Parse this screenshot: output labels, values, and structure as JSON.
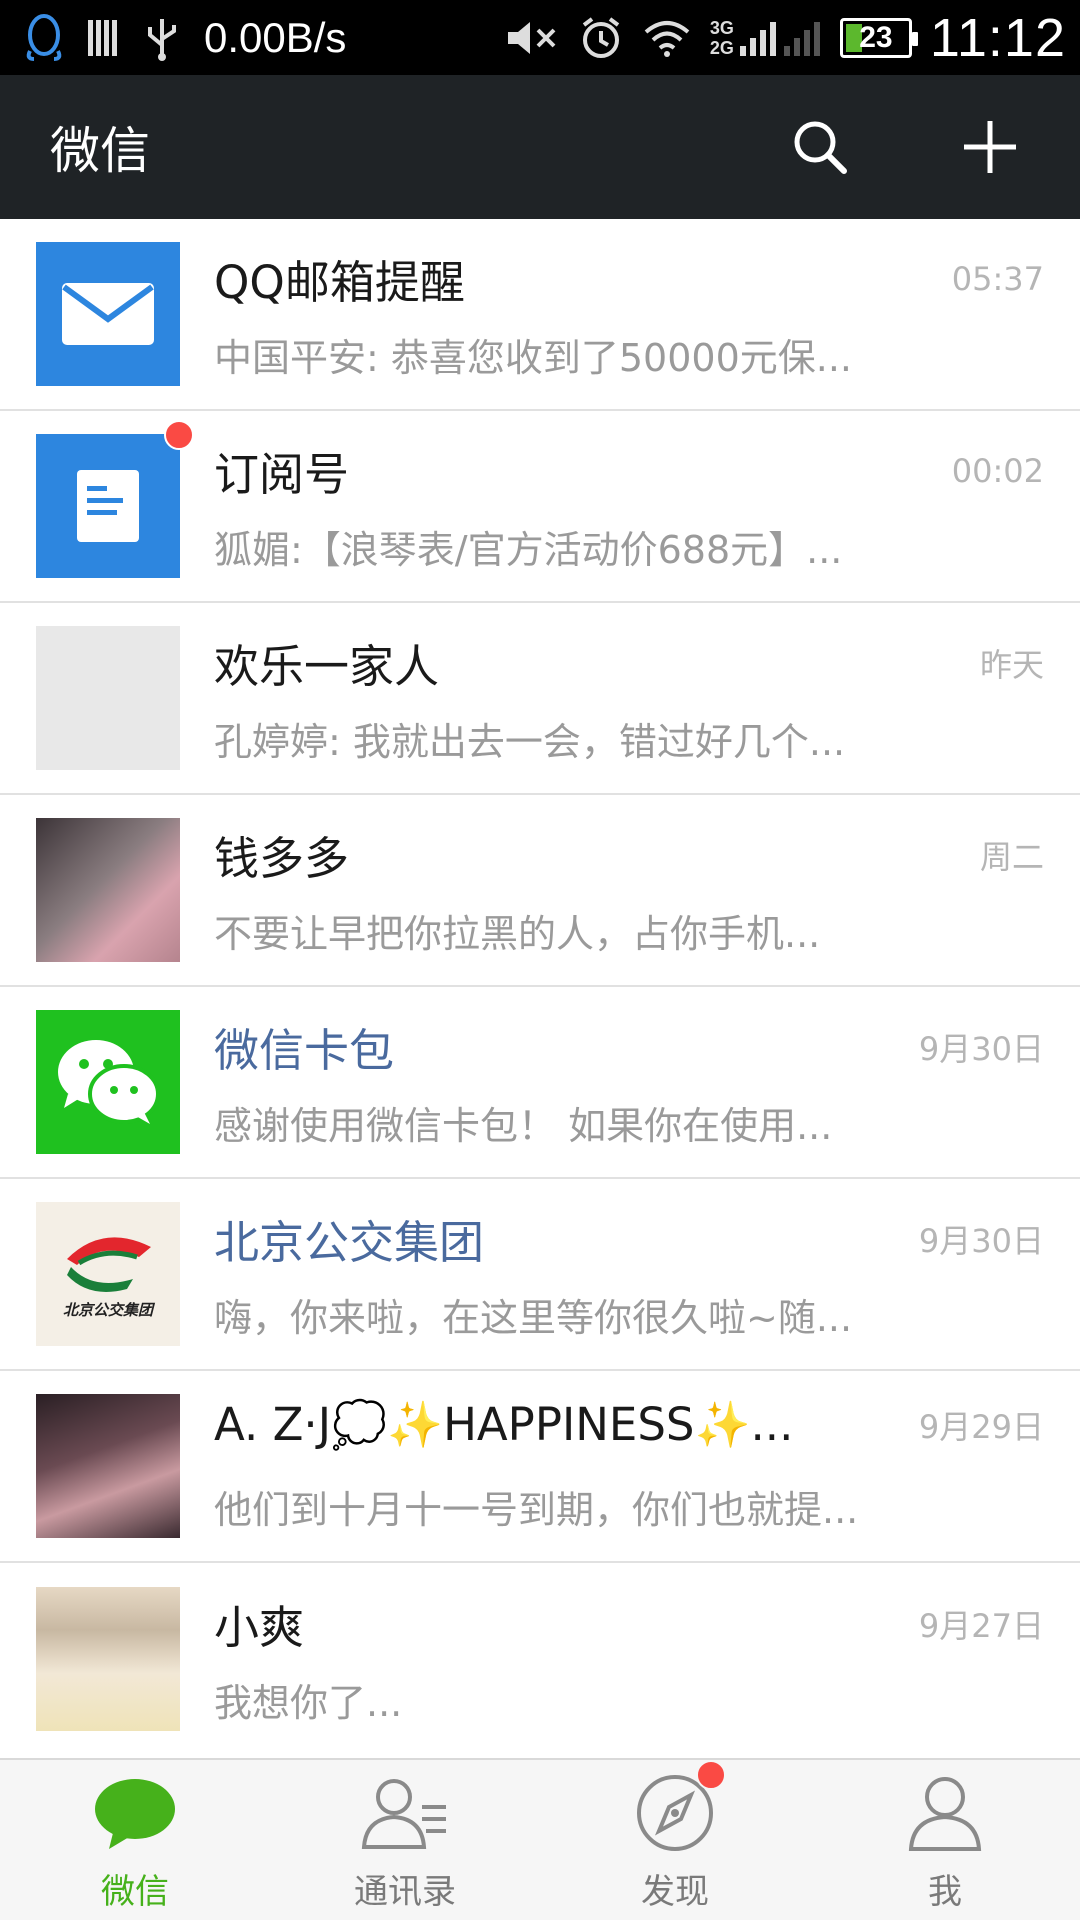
{
  "status_bar": {
    "net_speed": "0.00B/s",
    "network_3g": "3G",
    "network_2g": "2G",
    "battery": "23",
    "time": "11:12"
  },
  "appbar": {
    "title": "微信",
    "search_icon": "search-icon",
    "add_icon": "plus-icon"
  },
  "chats": [
    {
      "name": "QQ邮箱提醒",
      "time": "05:37",
      "preview": "中国平安: 恭喜您收到了50000元保...",
      "avatar": "mail-icon",
      "official": false
    },
    {
      "name": "订阅号",
      "time": "00:02",
      "preview": "狐媚:【浪琴表/官方活动价688元】...",
      "avatar": "document-icon",
      "official": false,
      "badge": true
    },
    {
      "name": "欢乐一家人",
      "time": "昨天",
      "preview": "孔婷婷: 我就出去一会，错过好几个...",
      "avatar": "group-avatar",
      "official": false
    },
    {
      "name": "钱多多",
      "time": "周二",
      "preview": " 不要让早把你拉黑的人，占你手机...",
      "avatar": "photo-avatar",
      "official": false
    },
    {
      "name": "微信卡包",
      "time": "9月30日",
      "preview": "感谢使用微信卡包！ 如果你在使用...",
      "avatar": "wechat-logo-icon",
      "official": true
    },
    {
      "name": "北京公交集团",
      "time": "9月30日",
      "preview": "嗨，你来啦，在这里等你很久啦~随...",
      "avatar": "bus-group-logo",
      "official": true,
      "logo_text": "北京公交集团"
    },
    {
      "name": "A.   Z·J💭✨HAPPINESS✨...",
      "time": "9月29日",
      "preview": "他们到十月十一号到期，你们也就提...",
      "avatar": "photo-avatar",
      "official": false
    },
    {
      "name": "小爽",
      "time": "9月27日",
      "preview": " 我想你了...",
      "avatar": "photo-avatar",
      "official": false
    }
  ],
  "bottom_nav": [
    {
      "label": "微信",
      "icon": "chat-bubble-icon",
      "active": true
    },
    {
      "label": "通讯录",
      "icon": "contacts-icon",
      "active": false
    },
    {
      "label": "发现",
      "icon": "compass-icon",
      "active": false,
      "badge": true
    },
    {
      "label": "我",
      "icon": "person-icon",
      "active": false
    }
  ],
  "colors": {
    "appbar_bg": "#1f2326",
    "accent_green": "#46b11b",
    "official_name": "#4a6a9e",
    "badge_red": "#fa4a44",
    "mail_blue": "#2d86df"
  }
}
